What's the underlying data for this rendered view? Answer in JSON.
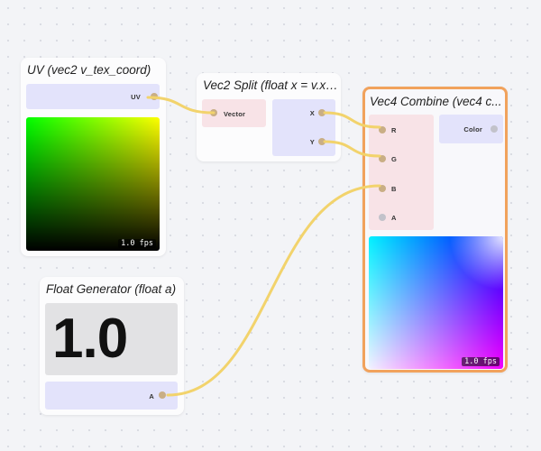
{
  "nodes": {
    "uv": {
      "title": "UV (vec2 v_tex_coord)",
      "output_label": "UV",
      "fps": "1.0 fps"
    },
    "split": {
      "title": "Vec2 Split (float x = v.x,...",
      "input_label": "Vector",
      "outputs": [
        "X",
        "Y"
      ]
    },
    "combine": {
      "title": "Vec4 Combine (vec4 c...",
      "inputs": [
        "R",
        "G",
        "B",
        "A"
      ],
      "output_label": "Color",
      "fps": "1.0 fps"
    },
    "float": {
      "title": "Float Generator (float a)",
      "value": "1.0",
      "output_label": "A"
    }
  },
  "wire_color": "#f2d36c",
  "selected_border_color": "#f1a25c",
  "input_panel_color": "#f8e3e7",
  "output_panel_color": "#e3e3fb",
  "port_color": "#c9ae85"
}
